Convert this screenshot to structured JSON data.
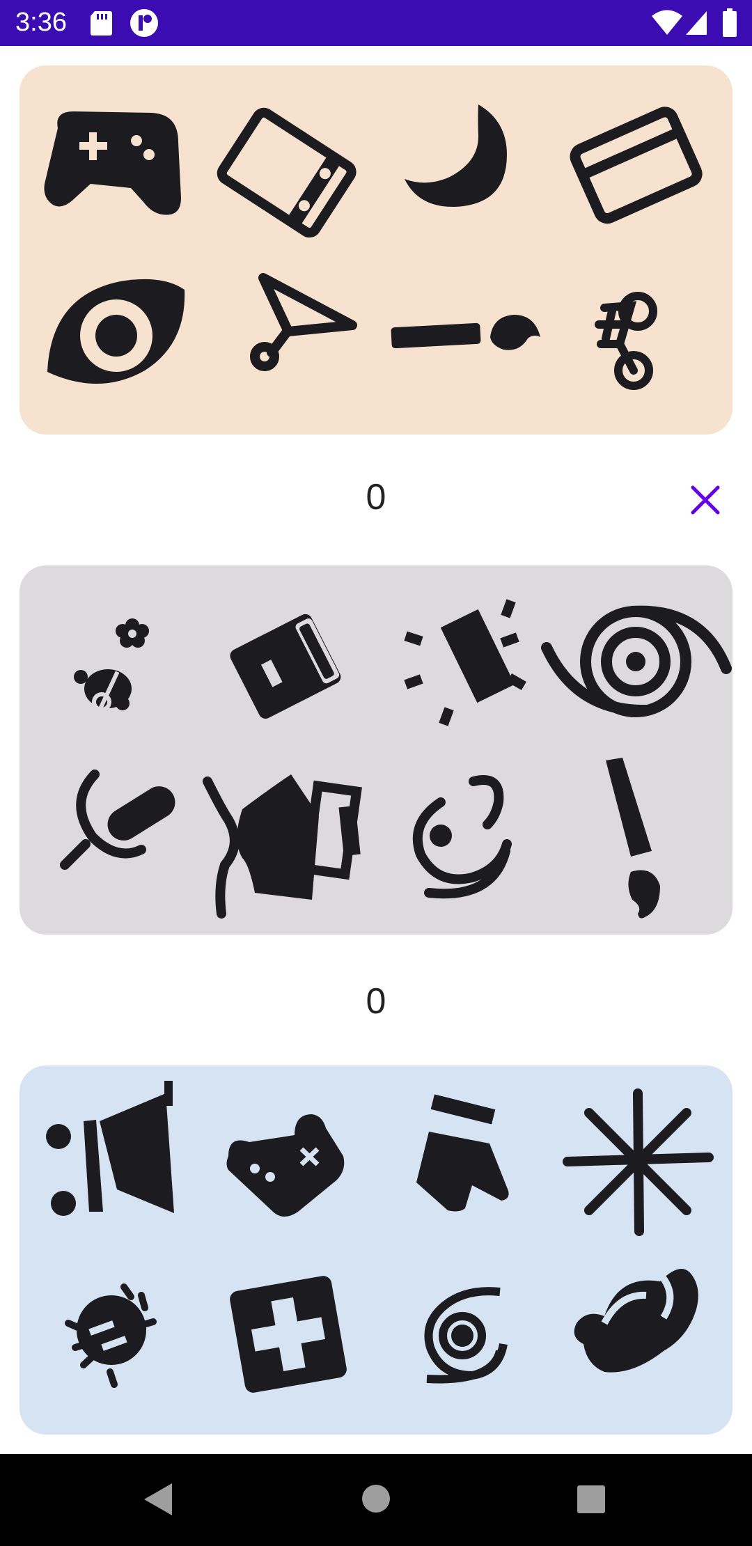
{
  "status_bar": {
    "time": "3:36",
    "icons": [
      "sd-card-icon",
      "app-notification-icon",
      "wifi-icon",
      "signal-icon",
      "battery-icon"
    ]
  },
  "cards": [
    {
      "background": "#f6e2cf",
      "icons": [
        "gamepad-icon",
        "ticket-icon",
        "moon-icon",
        "credit-card-icon",
        "eye-icon",
        "paper-plane-icon",
        "pin-line-icon",
        "bicycle-icon"
      ]
    },
    {
      "background": "#dcdadc",
      "icons": [
        "bee-flower-icon",
        "wallet-icon",
        "party-popper-icon",
        "tornado-icon",
        "microphone-icon",
        "video-call-icon",
        "pacifier-icon",
        "exclamation-icon"
      ]
    },
    {
      "background": "#d6e3f3",
      "icons": [
        "megaphone-icon",
        "controller-icon",
        "stocking-icon",
        "snowflake-icon",
        "bug-icon",
        "first-aid-icon",
        "spiral-icon",
        "hand-icon"
      ]
    }
  ],
  "counters": {
    "first": "0",
    "second": "0"
  },
  "colors": {
    "status_bar": "#3a0cb1",
    "accent": "#6200ee",
    "icon": "#1c1b1f",
    "nav_bar": "#000000"
  },
  "nav_bar": {
    "buttons": [
      "back-icon",
      "home-icon",
      "recents-icon"
    ]
  }
}
